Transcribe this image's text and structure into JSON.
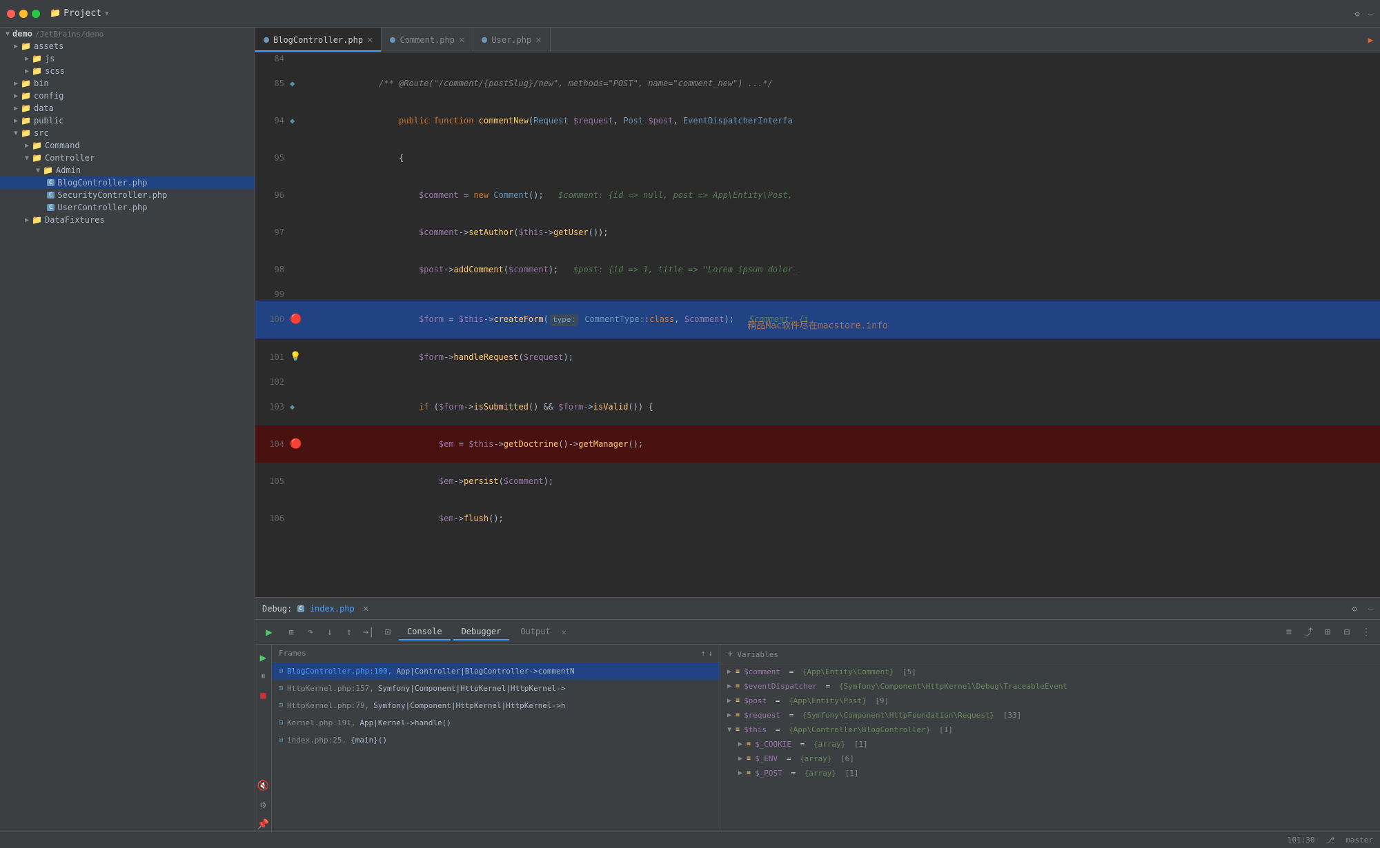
{
  "window": {
    "title": "Project",
    "tabs": [
      {
        "label": "BlogController.php",
        "active": true,
        "dot_color": "#6897bb"
      },
      {
        "label": "Comment.php",
        "active": false,
        "dot_color": "#6897bb"
      },
      {
        "label": "User.php",
        "active": false,
        "dot_color": "#6897bb"
      }
    ]
  },
  "sidebar": {
    "root": "demo",
    "root_path": "/JetBrains/demo",
    "items": [
      {
        "label": "assets",
        "type": "folder",
        "depth": 1,
        "open": false
      },
      {
        "label": "js",
        "type": "folder",
        "depth": 2,
        "open": false
      },
      {
        "label": "scss",
        "type": "folder",
        "depth": 2,
        "open": false
      },
      {
        "label": "bin",
        "type": "folder",
        "depth": 1,
        "open": false
      },
      {
        "label": "config",
        "type": "folder",
        "depth": 1,
        "open": false
      },
      {
        "label": "data",
        "type": "folder",
        "depth": 1,
        "open": false
      },
      {
        "label": "public",
        "type": "folder",
        "depth": 1,
        "open": false
      },
      {
        "label": "src",
        "type": "folder",
        "depth": 1,
        "open": true
      },
      {
        "label": "Command",
        "type": "folder",
        "depth": 2,
        "open": false
      },
      {
        "label": "Controller",
        "type": "folder",
        "depth": 2,
        "open": true
      },
      {
        "label": "Admin",
        "type": "folder",
        "depth": 3,
        "open": true
      },
      {
        "label": "BlogController.php",
        "type": "php",
        "depth": 4,
        "selected": true
      },
      {
        "label": "SecurityController.php",
        "type": "php",
        "depth": 4
      },
      {
        "label": "UserController.php",
        "type": "php",
        "depth": 4
      },
      {
        "label": "DataFixtures",
        "type": "folder",
        "depth": 2,
        "open": false
      }
    ]
  },
  "editor": {
    "lines": [
      {
        "num": 84,
        "content": "",
        "type": "normal"
      },
      {
        "num": 85,
        "content": "    /** @Route(\"/comment/{postSlug}/new\", methods=\"POST\", name=\"comment_new\") ...*/",
        "type": "comment-line"
      },
      {
        "num": 94,
        "content": "    public function commentNew(Request $request, Post $post, EventDispatcherInterfa",
        "type": "normal"
      },
      {
        "num": 95,
        "content": "    {",
        "type": "normal"
      },
      {
        "num": 96,
        "content": "        $comment = new Comment();   $comment: {id => null, post => App\\Entity\\Post,",
        "type": "normal"
      },
      {
        "num": 97,
        "content": "        $comment->setAuthor($this->getUser());",
        "type": "normal"
      },
      {
        "num": 98,
        "content": "        $post->addComment($comment);   $post: {id => 1, title => \"Lorem ipsum dolor_",
        "type": "normal"
      },
      {
        "num": 99,
        "content": "",
        "type": "normal"
      },
      {
        "num": 100,
        "content": "        $form = $this->createForm( type: CommentType::class, $comment);   $comment: {i",
        "type": "highlighted",
        "has_bp": true
      },
      {
        "num": 101,
        "content": "        $form->handleRequest($request);",
        "type": "bulb"
      },
      {
        "num": 102,
        "content": "",
        "type": "normal"
      },
      {
        "num": 103,
        "content": "        if ($form->isSubmitted() && $form->isValid()) {",
        "type": "normal"
      },
      {
        "num": 104,
        "content": "            $em = $this->getDoctrine()->getManager();",
        "type": "error",
        "has_bp": true
      },
      {
        "num": 105,
        "content": "            $em->persist($comment);",
        "type": "normal"
      },
      {
        "num": 106,
        "content": "            $em->flush();",
        "type": "normal"
      }
    ]
  },
  "debug": {
    "tab_label": "Debug:",
    "file": "index.php",
    "tabs": [
      "Console",
      "Debugger",
      "Output"
    ],
    "active_tab": "Debugger",
    "frames_header": "Frames",
    "frames": [
      {
        "file": "BlogController.php",
        "line": "100",
        "class": "App|Controller|BlogController",
        "method": "commentN",
        "active": true
      },
      {
        "file": "HttpKernel.php",
        "line": "157",
        "class": "Symfony|Component|HttpKernel|HttpKernel-",
        "method": "",
        "active": false
      },
      {
        "file": "HttpKernel.php",
        "line": "79",
        "class": "Symfony|Component|HttpKernel|HttpKernel->h",
        "method": "",
        "active": false
      },
      {
        "file": "Kernel.php",
        "line": "191",
        "class": "App|Kernel->handle()",
        "method": "",
        "active": false
      },
      {
        "file": "index.php",
        "line": "25",
        "class": "{main}()",
        "method": "",
        "active": false
      }
    ],
    "variables_header": "Variables",
    "variables": [
      {
        "name": "$comment",
        "value": "{App\\Entity\\Comment}",
        "count": "[5]",
        "expanded": false
      },
      {
        "name": "$eventDispatcher",
        "value": "{Symfony\\Component\\HttpKernel\\Debug\\TraceableEvent",
        "count": "",
        "expanded": false
      },
      {
        "name": "$post",
        "value": "{App\\Entity\\Post}",
        "count": "[9]",
        "expanded": false
      },
      {
        "name": "$request",
        "value": "{Symfony\\Component\\HttpFoundation\\Request}",
        "count": "[33]",
        "expanded": false
      },
      {
        "name": "$this",
        "value": "{App\\Controller\\BlogController}",
        "count": "[1]",
        "expanded": true
      },
      {
        "name": "$_COOKIE",
        "value": "{array}",
        "count": "[1]",
        "expanded": false
      },
      {
        "name": "$_ENV",
        "value": "{array}",
        "count": "[6]",
        "expanded": false
      },
      {
        "name": "$_POST",
        "value": "{array}",
        "count": "[1]",
        "expanded": false
      }
    ]
  },
  "status_bar": {
    "position": "101:30",
    "branch": "master"
  },
  "watermark": "精品Mac软件尽在macstore.info"
}
